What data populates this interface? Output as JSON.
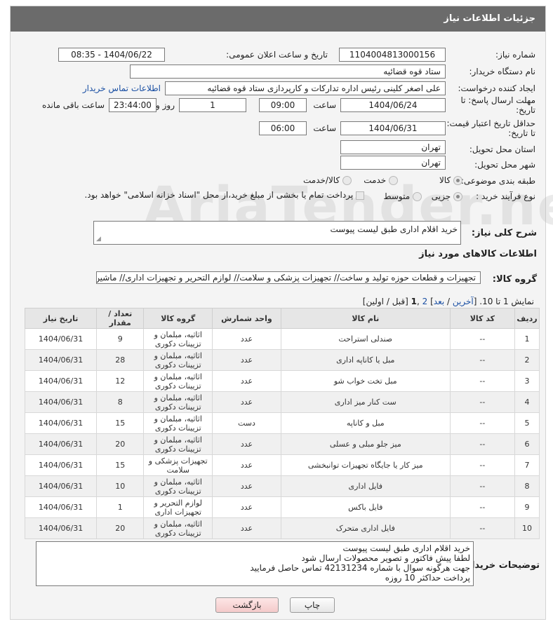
{
  "header": {
    "title": "جزئیات اطلاعات نیاز"
  },
  "fields": {
    "need_number_label": "شماره نیاز:",
    "need_number": "1104004813000156",
    "announce_label": "تاریخ و ساعت اعلان عمومی:",
    "announce_value": "1404/06/22 - 08:35",
    "buyer_org_label": "نام دستگاه خریدار:",
    "buyer_org": "ستاد قوه قضائیه",
    "creator_label": "ایجاد کننده درخواست:",
    "creator": "علی اصغر کلینی رئیس اداره تدارکات و کارپردازی ستاد قوه قضائیه",
    "contact_link": "اطلاعات تماس خریدار",
    "deadline_label_1": "مهلت ارسال پاسخ: تا",
    "deadline_label_2": "تاریخ:",
    "deadline_date": "1404/06/24",
    "time_label": "ساعت",
    "deadline_time": "09:00",
    "days_value": "1",
    "days_label": "روز و",
    "remaining_time": "23:44:00",
    "remaining_label": "ساعت باقی مانده",
    "price_label_1": "حداقل تاریخ اعتبار قیمت:",
    "price_label_2": "تا تاریخ:",
    "price_date": "1404/06/31",
    "price_time": "06:00",
    "province_label": "استان محل تحویل:",
    "province": "تهران",
    "city_label": "شهر محل تحویل:",
    "city": "تهران",
    "category_label": "طبقه بندی موضوعی:",
    "cat_goods": "کالا",
    "cat_service": "خدمت",
    "cat_goods_service": "کالا/خدمت",
    "process_label": "نوع فرآیند خرید :",
    "proc_small": "جزیی",
    "proc_medium": "متوسط",
    "payment_note": "پرداخت تمام یا بخشی از مبلغ خرید،از محل \"اسناد خزانه اسلامی\" خواهد بود."
  },
  "description": {
    "label": "شرح کلی نیاز:",
    "value": "خرید اقلام اداری طبق لیست پیوست"
  },
  "goods_section": {
    "title": "اطلاعات کالاهای مورد نیاز",
    "group_label": "گروه کالا:",
    "group_value": "تجهیزات و قطعات حوزه تولید و ساخت// تجهیزات پزشکی و سلامت// لوازم التحریر و تجهیزات اداری// ماشین آ"
  },
  "pagination": {
    "prefix": "نمایش 1 تا 10. [",
    "last": "آخرین",
    "sep1": " / ",
    "next": "بعد",
    "sep2": "] ",
    "page2": "2",
    "sep3": " ,",
    "page1": "1",
    "suffix": " [قبل / اولین]"
  },
  "table": {
    "headers": [
      "ردیف",
      "کد کالا",
      "نام کالا",
      "واحد شمارش",
      "گروه کالا",
      "تعداد / مقدار",
      "تاریخ نیاز"
    ],
    "rows": [
      [
        "1",
        "--",
        "صندلی استراحت",
        "عدد",
        "اثاثیه، مبلمان و تزیینات دکوری",
        "9",
        "1404/06/31"
      ],
      [
        "2",
        "--",
        "مبل یا کاناپه اداری",
        "عدد",
        "اثاثیه، مبلمان و تزیینات دکوری",
        "28",
        "1404/06/31"
      ],
      [
        "3",
        "--",
        "مبل تخت خواب شو",
        "عدد",
        "اثاثیه، مبلمان و تزیینات دکوری",
        "12",
        "1404/06/31"
      ],
      [
        "4",
        "--",
        "ست کنار میز اداری",
        "عدد",
        "اثاثیه، مبلمان و تزیینات دکوری",
        "8",
        "1404/06/31"
      ],
      [
        "5",
        "--",
        "مبل و کاناپه",
        "دست",
        "اثاثیه، مبلمان و تزیینات دکوری",
        "15",
        "1404/06/31"
      ],
      [
        "6",
        "--",
        "میز جلو مبلی و عسلی",
        "عدد",
        "اثاثیه، مبلمان و تزیینات دکوری",
        "20",
        "1404/06/31"
      ],
      [
        "7",
        "--",
        "میز کار یا جایگاه تجهیزات توانبخشی",
        "عدد",
        "تجهیزات پزشکی و سلامت",
        "15",
        "1404/06/31"
      ],
      [
        "8",
        "--",
        "فایل اداری",
        "عدد",
        "اثاثیه، مبلمان و تزیینات دکوری",
        "10",
        "1404/06/31"
      ],
      [
        "9",
        "--",
        "فایل باکس",
        "عدد",
        "لوازم التحریر و تجهیزات اداری",
        "1",
        "1404/06/31"
      ],
      [
        "10",
        "--",
        "فایل اداری متحرک",
        "عدد",
        "اثاثیه، مبلمان و تزیینات دکوری",
        "20",
        "1404/06/31"
      ]
    ]
  },
  "buyer_notes": {
    "label": "توضیحات خریدار:",
    "lines": [
      "خرید اقلام اداری طبق لیست پیوست",
      "لطفا پیش فاکتور و تصویر محصولات ارسال شود",
      "جهت هرگونه سوال با شماره 42131234 تماس حاصل فرمایید",
      "پرداخت حداکثر 10 روزه"
    ]
  },
  "buttons": {
    "print": "چاپ",
    "back": "بازگشت"
  },
  "watermark": "AriaTender.neT"
}
